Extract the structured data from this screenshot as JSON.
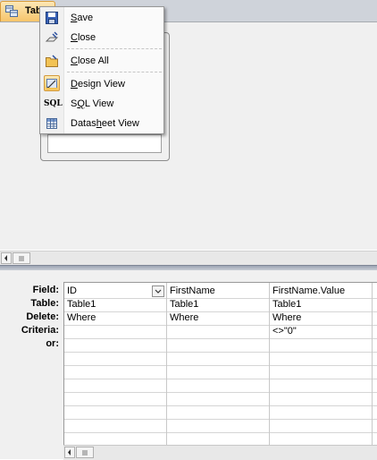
{
  "document_tab": {
    "label": "Tab",
    "icon": "query-icon"
  },
  "context_menu": {
    "items": [
      {
        "label": "Save",
        "accel": "S",
        "icon": "save-icon"
      },
      {
        "label": "Close",
        "accel": "C",
        "icon": "close-icon"
      },
      {
        "label": "Close All",
        "accel": "C",
        "icon": "close-all-icon"
      },
      {
        "label": "Design View",
        "accel": "D",
        "icon": "design-view-icon",
        "selected": true
      },
      {
        "label": "SQL View",
        "accel": "Q",
        "icon": "sql-icon"
      },
      {
        "label": "Datasheet View",
        "accel": "h",
        "icon": "datasheet-icon"
      }
    ],
    "sql_icon_text": "SQL"
  },
  "qbe": {
    "row_labels": [
      "Field:",
      "Table:",
      "Delete:",
      "Criteria:",
      "or:"
    ],
    "columns": [
      {
        "field": "ID",
        "table": "Table1",
        "delete": "Where",
        "criteria": ""
      },
      {
        "field": "FirstName",
        "table": "Table1",
        "delete": "Where",
        "criteria": ""
      },
      {
        "field": "FirstName.Value",
        "table": "Table1",
        "delete": "Where",
        "criteria": "<>\"0\""
      }
    ]
  },
  "colors": {
    "accent": "#f6c46a",
    "tab_border": "#d79b3c",
    "splitter": "#9ba3b3"
  }
}
